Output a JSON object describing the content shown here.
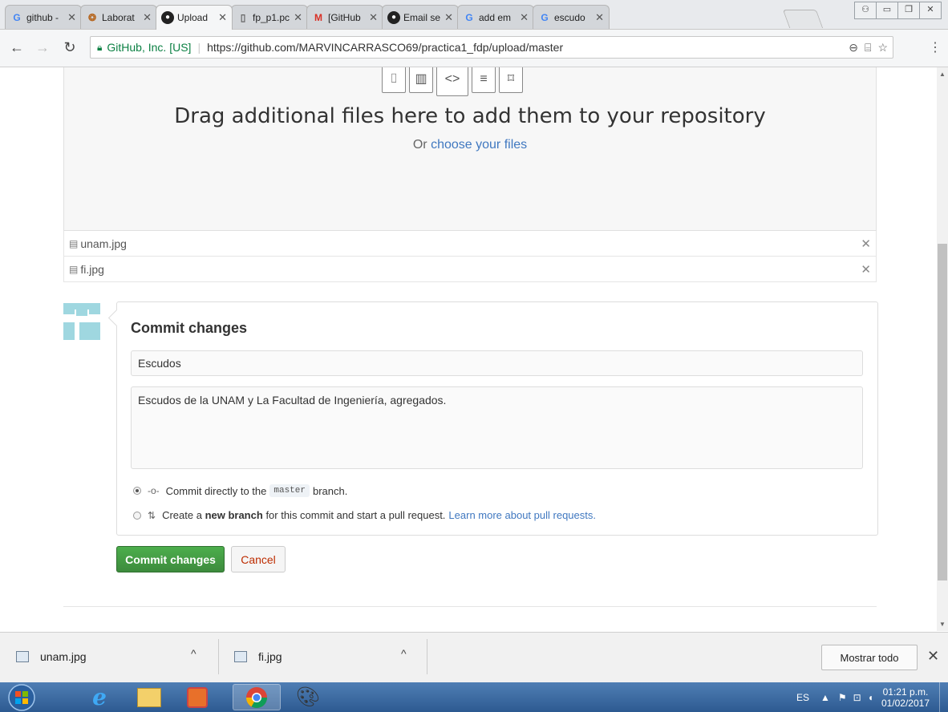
{
  "tabs": [
    {
      "label": "github -",
      "icon": "google-icon"
    },
    {
      "label": "Laborat",
      "icon": "unam-logo-icon"
    },
    {
      "label": "Upload",
      "icon": "github-icon",
      "active": true
    },
    {
      "label": "fp_p1.pc",
      "icon": "document-icon"
    },
    {
      "label": "[GitHub",
      "icon": "gmail-icon"
    },
    {
      "label": "Email se",
      "icon": "github-icon"
    },
    {
      "label": "add em",
      "icon": "google-icon"
    },
    {
      "label": "escudo",
      "icon": "google-icon"
    }
  ],
  "address": {
    "org": "GitHub, Inc. [US]",
    "url": "https://github.com/MARVINCARRASCO69/practica1_fdp/upload/master"
  },
  "upload": {
    "title": "Drag additional files here to add them to your repository",
    "or_text": "Or",
    "choose_link": "choose your files",
    "files": [
      "unam.jpg",
      "fi.jpg"
    ]
  },
  "commit": {
    "heading": "Commit changes",
    "summary": "Escudos",
    "description": "Escudos de la UNAM y La Facultad de Ingeniería, agregados.",
    "option_direct_pre": "Commit directly to the",
    "branch": "master",
    "option_direct_post": "branch.",
    "option_new_pre": "Create a",
    "option_new_bold": "new branch",
    "option_new_post": "for this commit and start a pull request.",
    "learn_more": "Learn more about pull requests.",
    "submit": "Commit changes",
    "cancel": "Cancel"
  },
  "downloads": {
    "items": [
      "unam.jpg",
      "fi.jpg"
    ],
    "show_all": "Mostrar todo"
  },
  "taskbar": {
    "lang": "ES",
    "time": "01:21 p.m.",
    "date": "01/02/2017"
  },
  "colors": {
    "accent_link": "#4078c0",
    "commit_green": "#3d8b3d",
    "cancel_red": "#bd2c00",
    "secure_green": "#0b8043"
  }
}
